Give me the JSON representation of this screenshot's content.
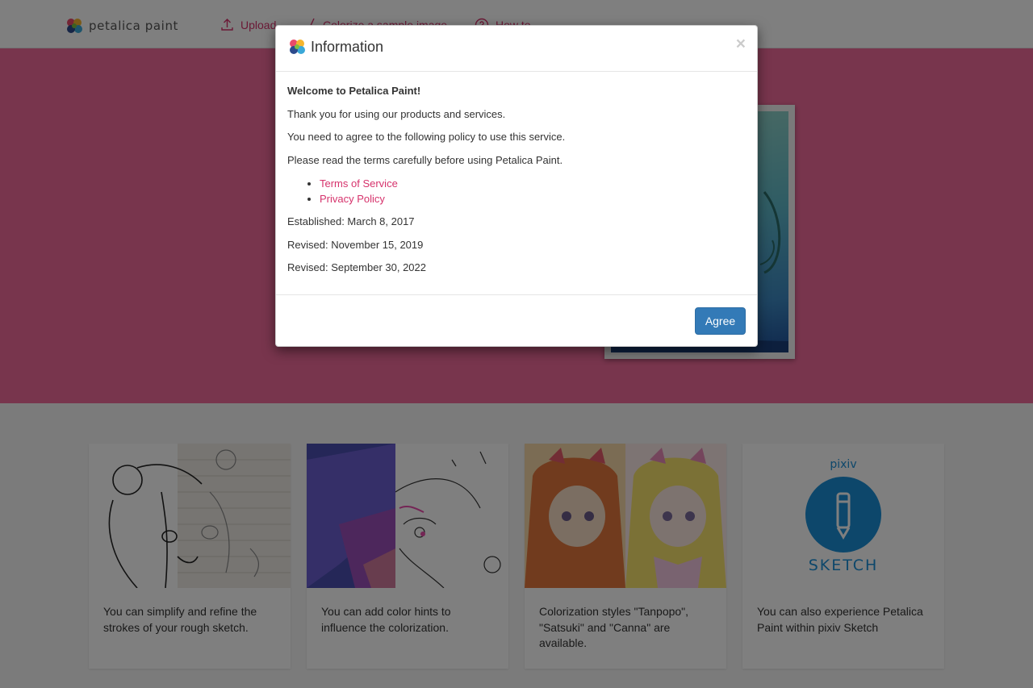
{
  "navbar": {
    "brand_name": "petalica paint",
    "items": [
      {
        "label": "Upload",
        "icon": "upload-icon"
      },
      {
        "label": "Colorize a sample image",
        "icon": "brush-icon"
      },
      {
        "label": "How to",
        "icon": "help-circle-icon"
      }
    ]
  },
  "features": [
    {
      "text": "You can simplify and refine the strokes of your rough sketch."
    },
    {
      "text": "You can add color hints to influence the colorization."
    },
    {
      "text": "Colorization styles \"Tanpopo\", \"Satsuki\" and \"Canna\" are available."
    },
    {
      "text": "You can also experience Petalica Paint within pixiv Sketch",
      "logo_top": "pixiv",
      "logo_bottom": "SKETCH"
    }
  ],
  "modal": {
    "title": "Information",
    "close_symbol": "×",
    "welcome": "Welcome to Petalica Paint!",
    "lines": [
      "Thank you for using our products and services.",
      "You need to agree to the following policy to use this service.",
      "Please read the terms carefully before using Petalica Paint."
    ],
    "links": [
      "Terms of Service",
      "Privacy Policy"
    ],
    "dates": [
      "Established: March 8, 2017",
      "Revised: November 15, 2019",
      "Revised: September 30, 2022"
    ],
    "agree_label": "Agree"
  },
  "colors": {
    "accent": "#d6336c",
    "hero": "#f06b9b",
    "primary_button": "#337ab7"
  }
}
